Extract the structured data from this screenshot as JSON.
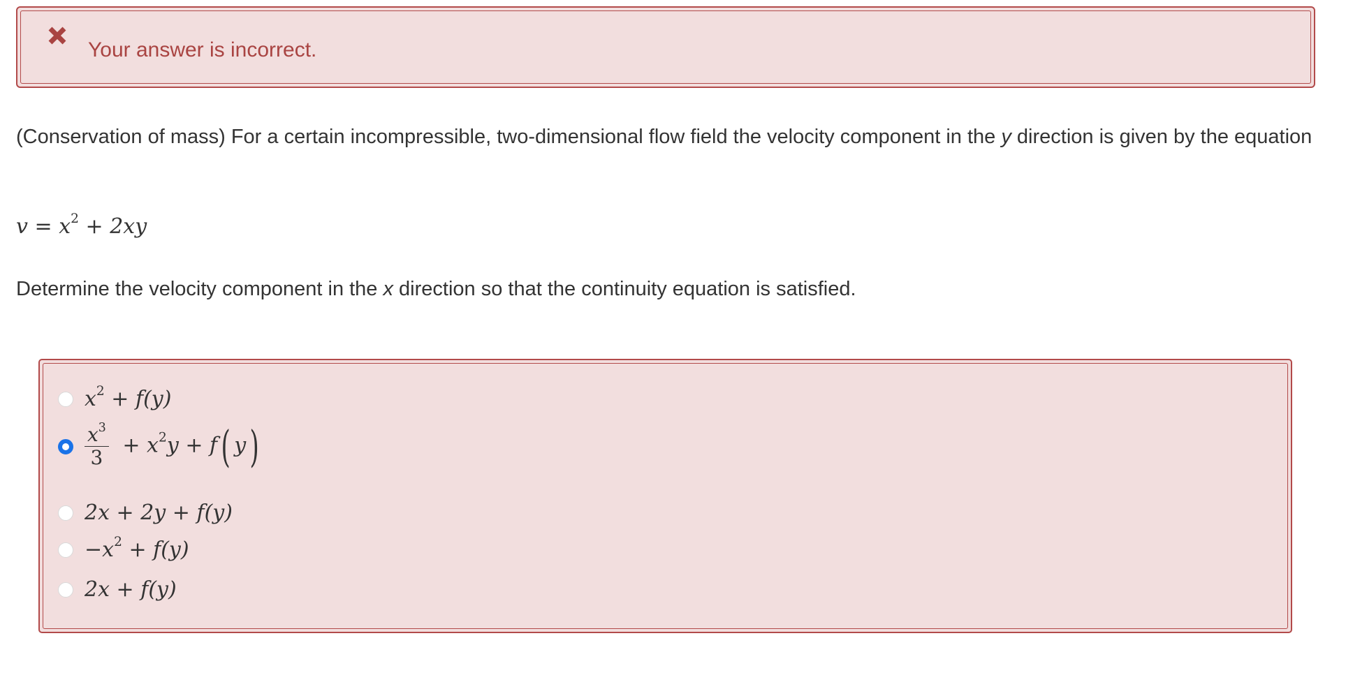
{
  "feedback": {
    "icon": "x-mark-icon",
    "text": "Your answer is incorrect.",
    "color": "#a94442",
    "background": "#f2dede"
  },
  "question": {
    "intro_before_var": "(Conservation of mass) For a certain incompressible, two-dimensional flow field the velocity component in the ",
    "intro_var": "y",
    "intro_after_var": " direction is given by the equation",
    "equation": {
      "lhs": "v",
      "eq": "=",
      "t1_base": "x",
      "t1_exp": "2",
      "plus": "+",
      "t2": "2xy"
    },
    "instruction_before_var": "Determine the velocity component in the ",
    "instruction_var": "x",
    "instruction_after_var": " direction so that the continuity equation is satisfied."
  },
  "options": [
    {
      "id": "a",
      "selected": false,
      "label": {
        "base": "x",
        "exp": "2",
        "rest": " + f(y)"
      }
    },
    {
      "id": "b",
      "selected": true,
      "label": {
        "num": "x3",
        "num_base": "x",
        "num_exp": "3",
        "den": "3",
        "middle_base": " + x",
        "middle_exp": "2",
        "middle_rest": "y + f",
        "paren_open": "(",
        "paren_inner": "y",
        "paren_close": ")"
      }
    },
    {
      "id": "c",
      "selected": false,
      "label": {
        "text": "2x + 2y + f(y)"
      }
    },
    {
      "id": "d",
      "selected": false,
      "label": {
        "prefix": "−x",
        "exp": "2",
        "rest": " + f(y)"
      }
    },
    {
      "id": "e",
      "selected": false,
      "label": {
        "text": "2x + f(y)"
      }
    }
  ],
  "colors": {
    "error_border": "#b24a4a",
    "radio_selected": "#1a73e8"
  }
}
